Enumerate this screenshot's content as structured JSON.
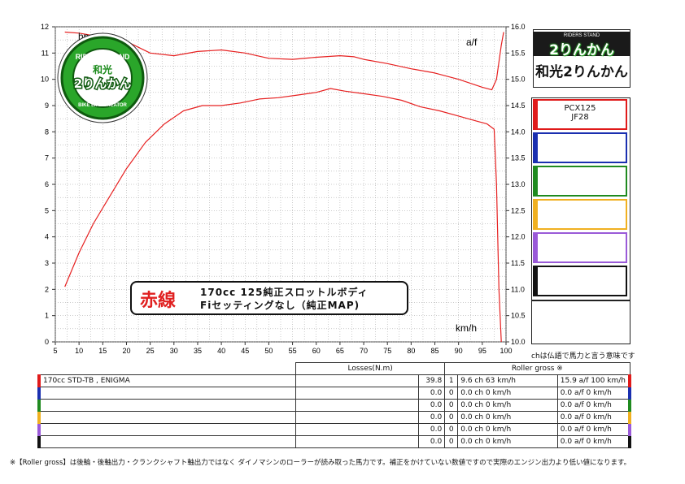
{
  "chart_data": {
    "type": "line",
    "title": "",
    "xlabel": "km/h",
    "ylabel_left": "hp",
    "ylabel_right": "a/f",
    "xlim": [
      5,
      100
    ],
    "ylim_left": [
      0,
      12
    ],
    "ylim_right": [
      10.0,
      16.0
    ],
    "x_ticks": [
      "5",
      "10",
      "15",
      "20",
      "25",
      "30",
      "35",
      "40",
      "45",
      "50",
      "55",
      "60",
      "65",
      "70",
      "75",
      "80",
      "85",
      "90",
      "95",
      "100"
    ],
    "y_ticks_left": [
      "0",
      "1",
      "2",
      "3",
      "4",
      "5",
      "6",
      "7",
      "8",
      "9",
      "10",
      "11",
      "12"
    ],
    "y_ticks_right": [
      "10.0",
      "10.5",
      "11.0",
      "11.5",
      "12.0",
      "12.5",
      "13.0",
      "13.5",
      "14.0",
      "14.5",
      "15.0",
      "15.5",
      "16.0"
    ],
    "grid": true,
    "series": [
      {
        "name": "hp",
        "axis": "left",
        "color": "#e62020",
        "x": [
          7,
          10,
          13,
          16,
          20,
          24,
          28,
          32,
          36,
          40,
          44,
          48,
          52,
          56,
          60,
          63,
          66,
          70,
          74,
          78,
          82,
          86,
          90,
          94,
          96,
          97.5,
          98,
          98.5,
          99
        ],
        "y": [
          2.1,
          3.4,
          4.5,
          5.4,
          6.6,
          7.6,
          8.3,
          8.8,
          9.0,
          9.0,
          9.1,
          9.25,
          9.3,
          9.4,
          9.5,
          9.65,
          9.55,
          9.45,
          9.35,
          9.2,
          8.95,
          8.8,
          8.6,
          8.4,
          8.3,
          8.1,
          6.0,
          2.0,
          0.0
        ]
      },
      {
        "name": "a/f",
        "axis": "right",
        "color": "#e62020",
        "x": [
          7,
          10,
          15,
          20,
          25,
          30,
          35,
          40,
          45,
          50,
          55,
          60,
          65,
          68,
          70,
          75,
          80,
          85,
          90,
          95,
          97,
          98,
          99,
          99.5
        ],
        "y": [
          15.9,
          15.88,
          15.8,
          15.72,
          15.5,
          15.45,
          15.53,
          15.56,
          15.5,
          15.4,
          15.38,
          15.42,
          15.45,
          15.43,
          15.38,
          15.3,
          15.2,
          15.12,
          15.0,
          14.85,
          14.8,
          15.0,
          15.65,
          15.9
        ]
      }
    ],
    "annotations": [
      "hp",
      "a/f",
      "km/h"
    ]
  },
  "panel": {
    "brand_small": "RIDERS STAND",
    "brand_big": "2りんかん",
    "store_name": "和光2りんかん",
    "legend": [
      {
        "line1": "PCX125",
        "line2": "JF28",
        "color": "#e01a1a"
      },
      {
        "line1": "",
        "line2": "",
        "color": "#1a2fb0"
      },
      {
        "line1": "",
        "line2": "",
        "color": "#1f8a1f"
      },
      {
        "line1": "",
        "line2": "",
        "color": "#f0b020"
      },
      {
        "line1": "",
        "line2": "",
        "color": "#9a5ad8"
      },
      {
        "line1": "",
        "line2": "",
        "color": "#111111"
      }
    ],
    "ch_note": "chは仏語で馬力と言う意味です"
  },
  "left_logo": {
    "top_text": "RIDERS STAND",
    "mid_text": "和光",
    "big_text": "2りんかん",
    "bottom_text": "BIKE LIFE CREATOR"
  },
  "note": {
    "red_label": "赤線",
    "line1": "170cc 125純正スロットルボディ",
    "line2": "Fiセッティングなし（純正MAP)"
  },
  "table": {
    "losses_header": "Losses(N.m)",
    "roller_header": "Roller gross ※",
    "rows": [
      {
        "name": "170cc STD-TB , ENIGMA",
        "loss1": "39.8",
        "loss2": "1",
        "speed": "9.6 ch 63 km/h",
        "af": "15.9 a/f 100 km/h",
        "color": "#e01a1a"
      },
      {
        "name": "",
        "loss1": "0.0",
        "loss2": "0",
        "speed": "0.0 ch 0 km/h",
        "af": "0.0 a/f 0 km/h",
        "color": "#1a2fb0"
      },
      {
        "name": "",
        "loss1": "0.0",
        "loss2": "0",
        "speed": "0.0 ch 0 km/h",
        "af": "0.0 a/f 0 km/h",
        "color": "#1f8a1f"
      },
      {
        "name": "",
        "loss1": "0.0",
        "loss2": "0",
        "speed": "0.0 ch 0 km/h",
        "af": "0.0 a/f 0 km/h",
        "color": "#f0b020"
      },
      {
        "name": "",
        "loss1": "0.0",
        "loss2": "0",
        "speed": "0.0 ch 0 km/h",
        "af": "0.0 a/f 0 km/h",
        "color": "#9a5ad8"
      },
      {
        "name": "",
        "loss1": "0.0",
        "loss2": "0",
        "speed": "0.0 ch 0 km/h",
        "af": "0.0 a/f 0 km/h",
        "color": "#111111"
      }
    ]
  },
  "footnote": "※【Roller gross】は後輪・後軸出力・クランクシャフト軸出力ではなく ダイノマシンのローラーが読み取った馬力です。補正をかけていない数値ですので実際のエンジン出力より低い値になります。"
}
